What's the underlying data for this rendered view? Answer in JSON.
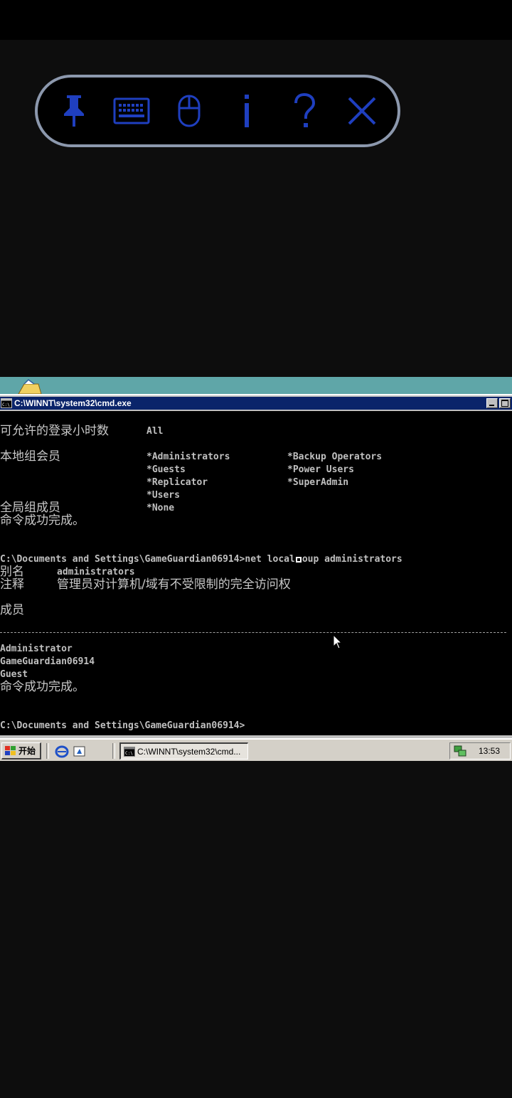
{
  "colors": {
    "toolbar_icon": "#1f3fbf",
    "toolbar_border": "#8c98ad",
    "titlebar": "#0a246a",
    "desktop": "#5fa6a8",
    "taskbar": "#d4d0c8"
  },
  "toolbar": {
    "icons": [
      "pin-icon",
      "keyboard-icon",
      "mouse-icon",
      "info-icon",
      "help-icon",
      "close-icon"
    ]
  },
  "window": {
    "title": "C:\\WINNT\\system32\\cmd.exe"
  },
  "console": {
    "logon_hours_label": "可允许的登录小时数",
    "logon_hours_value": "All",
    "local_groups_label": "本地组会员",
    "local_groups_col1": [
      "*Administrators",
      "*Guests",
      "*Replicator",
      "*Users"
    ],
    "local_groups_col2": [
      "*Backup Operators",
      "*Power Users",
      "*SuperAdmin"
    ],
    "global_groups_label": "全局组成员",
    "global_groups_value": "*None",
    "success_1": "命令成功完成。",
    "prompt_1_path": "C:\\Documents and Settings\\GameGuardian06914>",
    "command_part1": "net local",
    "command_part2": "oup administrators",
    "alias_label": "别名",
    "alias_value": "administrators",
    "comment_label": "注释",
    "comment_value": "管理员对计算机/域有不受限制的完全访问权",
    "members_label": "成员",
    "members": [
      "Administrator",
      "GameGuardian06914",
      "Guest"
    ],
    "success_2": "命令成功完成。",
    "prompt_2": "C:\\Documents and Settings\\GameGuardian06914>"
  },
  "taskbar": {
    "start_label": "开始",
    "task_label": "C:\\WINNT\\system32\\cmd...",
    "clock": "13:53"
  }
}
